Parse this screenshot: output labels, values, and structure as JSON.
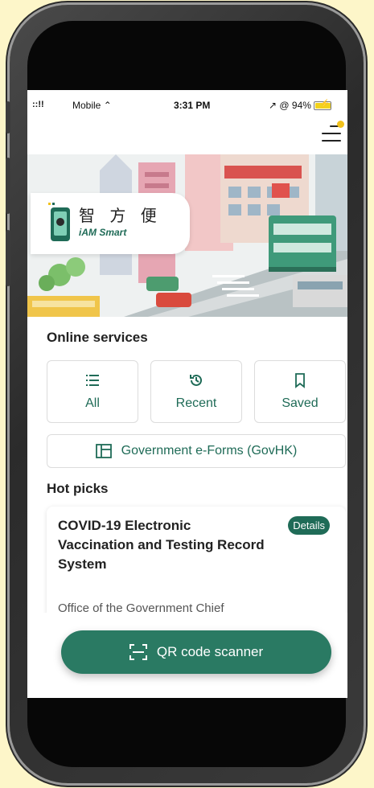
{
  "status_bar": {
    "signal": "::!!",
    "carrier": "Mobile",
    "time": "3:31 PM",
    "right": "↗ @ 94%",
    "battery_level": 0.94
  },
  "banner": {
    "logo_chinese": "智 方 便",
    "logo_name": "iAM Smart"
  },
  "online_services": {
    "title": "Online services",
    "buttons": [
      {
        "label": "All",
        "icon": "list-icon"
      },
      {
        "label": "Recent",
        "icon": "history-icon"
      },
      {
        "label": "Saved",
        "icon": "bookmark-icon"
      }
    ],
    "eform_label": "Government e-Forms (GovHK)"
  },
  "hot_picks": {
    "title": "Hot picks",
    "card": {
      "title": "COVID-19 Electronic Vaccination and Testing Record System",
      "badge": "Details",
      "org": "Office of the Government Chief"
    }
  },
  "qr_button": {
    "label": "QR code scanner",
    "icon": "qr-scan-icon"
  },
  "colors": {
    "accent": "#1f6b57",
    "qr_button": "#2a7a63",
    "notification_dot": "#f2c21c",
    "page_background": "#fdf6c9"
  }
}
